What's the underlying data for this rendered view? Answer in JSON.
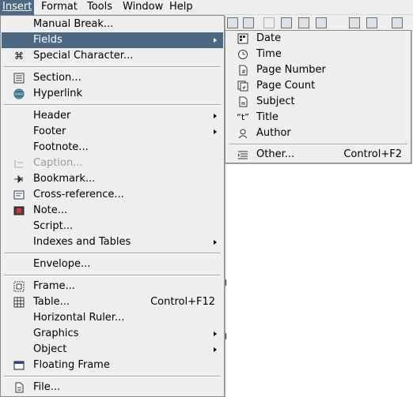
{
  "menubar": {
    "items": [
      "Insert",
      "Format",
      "Tools",
      "Window",
      "Help"
    ]
  },
  "insert_menu": {
    "items": [
      {
        "label": "Manual Break...",
        "icon": "none"
      },
      {
        "label": "Fields",
        "icon": "none",
        "submenu": true,
        "highlighted": true
      },
      {
        "label": "Special Character...",
        "icon": "special-character-icon"
      },
      {
        "label": "Section...",
        "icon": "section-icon"
      },
      {
        "label": "Hyperlink",
        "icon": "hyperlink-icon"
      },
      {
        "label": "Header",
        "icon": "none",
        "submenu": true
      },
      {
        "label": "Footer",
        "icon": "none",
        "submenu": true
      },
      {
        "label": "Footnote...",
        "icon": "none"
      },
      {
        "label": "Caption...",
        "icon": "caption-icon",
        "disabled": true
      },
      {
        "label": "Bookmark...",
        "icon": "bookmark-icon"
      },
      {
        "label": "Cross-reference...",
        "icon": "cross-reference-icon"
      },
      {
        "label": "Note...",
        "icon": "note-icon"
      },
      {
        "label": "Script...",
        "icon": "none"
      },
      {
        "label": "Indexes and Tables",
        "icon": "none",
        "submenu": true
      },
      {
        "label": "Envelope...",
        "icon": "none"
      },
      {
        "label": "Frame...",
        "icon": "frame-icon"
      },
      {
        "label": "Table...",
        "icon": "table-icon",
        "accel": "Control+F12"
      },
      {
        "label": "Horizontal Ruler...",
        "icon": "none"
      },
      {
        "label": "Graphics",
        "icon": "none",
        "submenu": true
      },
      {
        "label": "Object",
        "icon": "none",
        "submenu": true
      },
      {
        "label": "Floating Frame",
        "icon": "floating-frame-icon"
      },
      {
        "label": "File...",
        "icon": "file-icon"
      }
    ]
  },
  "fields_menu": {
    "items": [
      {
        "label": "Date",
        "icon": "date-icon"
      },
      {
        "label": "Time",
        "icon": "time-icon"
      },
      {
        "label": "Page Number",
        "icon": "page-number-icon"
      },
      {
        "label": "Page Count",
        "icon": "page-count-icon"
      },
      {
        "label": "Subject",
        "icon": "subject-icon"
      },
      {
        "label": "Title",
        "icon": "title-icon"
      },
      {
        "label": "Author",
        "icon": "author-icon"
      },
      {
        "label": "Other...",
        "icon": "other-icon",
        "accel": "Control+F2"
      }
    ]
  },
  "colors": {
    "highlight": "#4b6983",
    "menu_bg": "#efefef",
    "disabled_text": "#9a9a9a"
  }
}
